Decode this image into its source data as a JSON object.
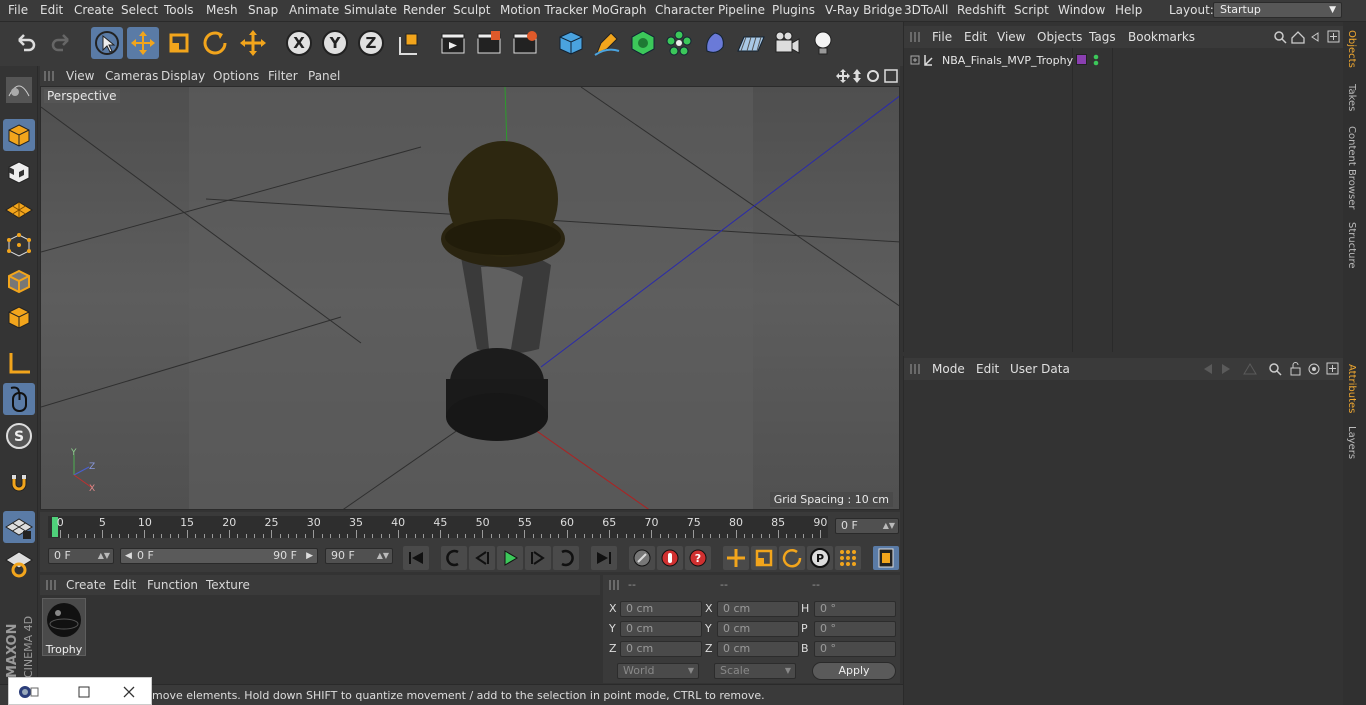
{
  "menubar": {
    "items": [
      "File",
      "Edit",
      "Create",
      "Select",
      "Tools",
      "Mesh",
      "Snap",
      "Animate",
      "Simulate",
      "Render",
      "Sculpt",
      "Motion Tracker",
      "MoGraph",
      "Character",
      "Pipeline",
      "Plugins",
      "V-Ray Bridge",
      "3DToAll",
      "Redshift",
      "Script",
      "Window",
      "Help"
    ],
    "layout_label": "Layout:",
    "layout_value": "Startup"
  },
  "viewport": {
    "menu": [
      "View",
      "Cameras",
      "Display",
      "Options",
      "Filter",
      "Panel"
    ],
    "camera_label": "Perspective",
    "grid_spacing": "Grid Spacing : 10 cm"
  },
  "timeline": {
    "ticks": [
      "0",
      "5",
      "10",
      "15",
      "20",
      "25",
      "30",
      "35",
      "40",
      "45",
      "50",
      "55",
      "60",
      "65",
      "70",
      "75",
      "80",
      "85",
      "90"
    ],
    "frame_right": "0 F",
    "start_field": "0 F",
    "range_start": "0 F",
    "range_end": "90 F",
    "end_field": "90 F"
  },
  "materials": {
    "menu": [
      "Create",
      "Edit",
      "Function",
      "Texture"
    ],
    "items": [
      {
        "name": "Trophy"
      }
    ]
  },
  "coords": {
    "headers": [
      "--",
      "--",
      "--"
    ],
    "rows": [
      {
        "l1": "X",
        "v1": "0 cm",
        "l2": "X",
        "v2": "0 cm",
        "l3": "H",
        "v3": "0 °"
      },
      {
        "l1": "Y",
        "v1": "0 cm",
        "l2": "Y",
        "v2": "0 cm",
        "l3": "P",
        "v3": "0 °"
      },
      {
        "l1": "Z",
        "v1": "0 cm",
        "l2": "Z",
        "v2": "0 cm",
        "l3": "B",
        "v3": "0 °"
      }
    ],
    "world": "World",
    "scale": "Scale",
    "apply": "Apply"
  },
  "status": {
    "text": "move elements. Hold down SHIFT to quantize movement / add to the selection in point mode, CTRL to remove."
  },
  "objects": {
    "menu": [
      "File",
      "Edit",
      "View",
      "Objects",
      "Tags",
      "Bookmarks"
    ],
    "tree": [
      {
        "name": "NBA_Finals_MVP_Trophy",
        "tag_color": "#8a3fb0"
      }
    ]
  },
  "attributes": {
    "menu": [
      "Mode",
      "Edit",
      "User Data"
    ]
  },
  "sidetabs": [
    "Objects",
    "Takes",
    "Content Browser",
    "Structure",
    "Attributes",
    "Layers"
  ],
  "brand": {
    "company": "MAXON",
    "product": "CINEMA 4D"
  },
  "colors": {
    "accent_blue": "#5a7ba6",
    "play_green": "#3cc85a",
    "help_red": "#d03030"
  }
}
